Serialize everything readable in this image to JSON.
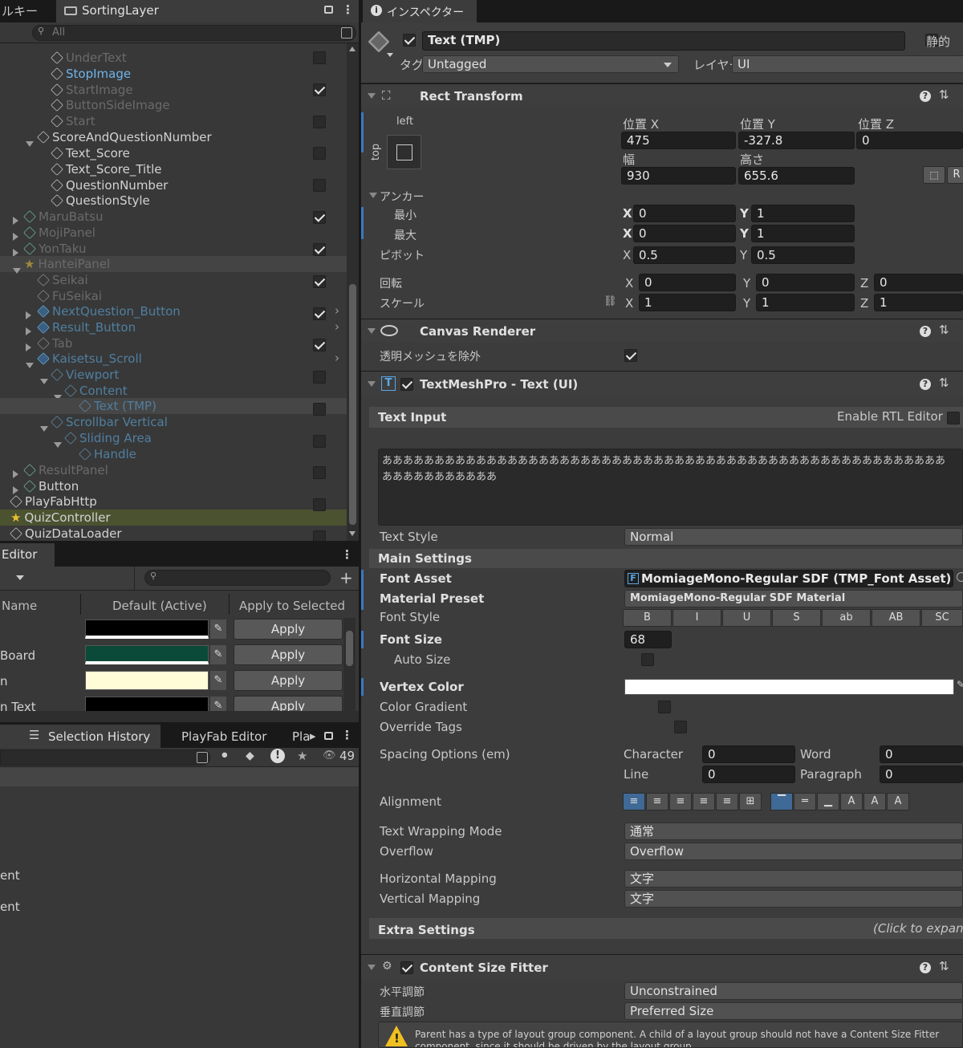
{
  "hierarchy": {
    "tab_label": "ルキー",
    "sorting_tab": "SortingLayer",
    "search_placeholder": "All",
    "items": [
      {
        "label": "UnderText",
        "style": "dim"
      },
      {
        "label": "StopImage",
        "style": "blue"
      },
      {
        "label": "StartImage",
        "style": "dim"
      },
      {
        "label": "ButtonSideImage",
        "style": "dim"
      },
      {
        "label": "Start",
        "style": "dim"
      },
      {
        "label": "ScoreAndQuestionNumber",
        "style": "normal"
      },
      {
        "label": "Text_Score",
        "style": "normal"
      },
      {
        "label": "Text_Score_Title",
        "style": "normal"
      },
      {
        "label": "QuestionNumber",
        "style": "normal"
      },
      {
        "label": "QuestionStyle",
        "style": "normal"
      },
      {
        "label": "MaruBatsu",
        "style": "dim"
      },
      {
        "label": "MojiPanel",
        "style": "dim"
      },
      {
        "label": "YonTaku",
        "style": "dim"
      },
      {
        "label": "HanteiPanel",
        "style": "dim"
      },
      {
        "label": "Seikai",
        "style": "dim"
      },
      {
        "label": "FuSeikai",
        "style": "dim"
      },
      {
        "label": "NextQuestion_Button",
        "style": "dimblue"
      },
      {
        "label": "Result_Button",
        "style": "dimblue"
      },
      {
        "label": "Tab",
        "style": "dim"
      },
      {
        "label": "Kaisetsu_Scroll",
        "style": "dimblue"
      },
      {
        "label": "Viewport",
        "style": "dimblue"
      },
      {
        "label": "Content",
        "style": "dimblue"
      },
      {
        "label": "Text (TMP)",
        "style": "dimblue"
      },
      {
        "label": "Scrollbar Vertical",
        "style": "dimblue"
      },
      {
        "label": "Sliding Area",
        "style": "dimblue"
      },
      {
        "label": "Handle",
        "style": "dimblue"
      },
      {
        "label": "ResultPanel",
        "style": "dim"
      },
      {
        "label": "Button",
        "style": "normal"
      },
      {
        "label": "PlayFabHttp",
        "style": "normal"
      },
      {
        "label": "QuizController",
        "style": "normal"
      },
      {
        "label": "QuizDataLoader",
        "style": "normal"
      }
    ]
  },
  "editor_panel": {
    "tab_label": "Editor",
    "col_name": "Name",
    "col_default": "Default (Active)",
    "col_apply": "Apply to Selected",
    "rows": [
      {
        "name": "",
        "color": "#000000",
        "apply": "Apply"
      },
      {
        "name": "Board",
        "color": "#0b4a38",
        "apply": "Apply"
      },
      {
        "name": "n",
        "color": "#fffdd8",
        "apply": "Apply"
      },
      {
        "name": "n Text",
        "color": "#000000",
        "apply": "Apply"
      }
    ]
  },
  "bottom_tabs": {
    "selection_history": "Selection History",
    "playfab_editor": "PlayFab Editor",
    "pla": "Pla",
    "count": "49"
  },
  "bottom_left_labels": [
    "ent",
    "ent"
  ],
  "inspector": {
    "tab_label": "インスペクター",
    "object_name": "Text (TMP)",
    "static_label": "静的",
    "tag_label": "タグ",
    "tag_value": "Untagged",
    "layer_label": "レイヤー",
    "layer_value": "UI",
    "rect_transform": {
      "title": "Rect Transform",
      "anchor_h": "left",
      "anchor_v": "top",
      "pos_x_label": "位置 X",
      "pos_y_label": "位置 Y",
      "pos_z_label": "位置 Z",
      "pos_x": "475",
      "pos_y": "-327.8",
      "pos_z": "0",
      "width_label": "幅",
      "height_label": "高さ",
      "width": "930",
      "height": "655.6",
      "r_btn": "R",
      "anchors_label": "アンカー",
      "min_label": "最小",
      "max_label": "最大",
      "min_x": "0",
      "min_y": "1",
      "max_x": "0",
      "max_y": "1",
      "pivot_label": "ピボット",
      "pivot_x": "0.5",
      "pivot_y": "0.5",
      "rotation_label": "回転",
      "rot_x": "0",
      "rot_y": "0",
      "rot_z": "0",
      "scale_label": "スケール",
      "scale_x": "1",
      "scale_y": "1",
      "scale_z": "1",
      "x": "X",
      "y": "Y",
      "z": "Z"
    },
    "canvas_renderer": {
      "title": "Canvas Renderer",
      "cull_label": "透明メッシュを除外"
    },
    "tmp": {
      "title": "TextMeshPro - Text (UI)",
      "text_input": "Text Input",
      "rtl": "Enable RTL Editor",
      "text_line1": "ああああああああああああああああああああああああああああああああああああああああああああああああああああああ",
      "text_line2": "あああああああああああ",
      "text_style_label": "Text Style",
      "text_style": "Normal",
      "main_settings": "Main Settings",
      "font_asset_label": "Font Asset",
      "font_asset": "MomiageMono-Regular SDF (TMP_Font Asset)",
      "material_label": "Material Preset",
      "material": "MomiageMono-Regular SDF Material",
      "font_style_label": "Font Style",
      "font_styles": [
        "B",
        "I",
        "U",
        "S",
        "ab",
        "AB",
        "SC"
      ],
      "font_size_label": "Font Size",
      "font_size": "68",
      "auto_size_label": "Auto Size",
      "vertex_color_label": "Vertex Color",
      "gradient_label": "Color Gradient",
      "override_label": "Override Tags",
      "spacing_label": "Spacing Options (em)",
      "character_label": "Character",
      "character": "0",
      "word_label": "Word",
      "word": "0",
      "line_label": "Line",
      "line": "0",
      "paragraph_label": "Paragraph",
      "paragraph": "0",
      "alignment_label": "Alignment",
      "wrapping_label": "Text Wrapping Mode",
      "wrapping": "通常",
      "overflow_label": "Overflow",
      "overflow": "Overflow",
      "hmap_label": "Horizontal Mapping",
      "hmap": "文字",
      "vmap_label": "Vertical Mapping",
      "vmap": "文字",
      "extra_settings": "Extra Settings",
      "click_expand": "(Click to expand"
    },
    "content_size_fitter": {
      "title": "Content Size Fitter",
      "h_label": "水平調節",
      "h_value": "Unconstrained",
      "v_label": "垂直調節",
      "v_value": "Preferred Size",
      "warning_line1": "Parent has a type of layout group component. A child of a layout group should not have a Content Size Fitter",
      "warning_line2": "component, since it should be driven by the layout group."
    }
  }
}
